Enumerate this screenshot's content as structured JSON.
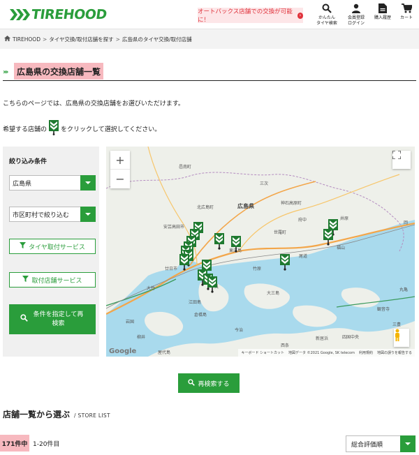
{
  "header": {
    "logo_text": "TIREHOOD",
    "promo_text": "オートバックス店舗での交換が可能に！",
    "nav": [
      {
        "label": "かんたん\nタイヤ検索",
        "icon": "search-icon"
      },
      {
        "label": "会員登録\nログイン",
        "icon": "user-icon"
      },
      {
        "label": "購入履歴",
        "icon": "document-icon"
      },
      {
        "label": "カート",
        "icon": "cart-icon"
      }
    ]
  },
  "breadcrumb": {
    "items": [
      "TIREHOOD",
      "タイヤ交換/取付店舗を探す",
      "広島県のタイヤ交換/取付店舗"
    ],
    "separator": ">"
  },
  "page": {
    "title": "広島県の交換店舗一覧",
    "intro1": "こちらのページでは、広島県の交換店舗をお選びいただけます。",
    "intro2_before": "希望する店舗の",
    "intro2_after": "をクリックして選択してください。"
  },
  "filter": {
    "heading": "絞り込み条件",
    "prefecture": "広島県",
    "city": "市区町村で絞り込む",
    "service_tire": "タイヤ取付サービス",
    "service_shop": "取付店舗サービス",
    "apply_label": "条件を指定して再検索"
  },
  "map": {
    "labels": {
      "prefecture": "広島県",
      "hamada": "浜田",
      "mihara": "三次",
      "ichi": "邑南町",
      "akitaka": "安芸高田市",
      "kitahiro": "北広島町",
      "sera": "世羅町",
      "fuchu": "府中",
      "jinseki": "神石高原町",
      "ibara": "井原",
      "oka": "岡",
      "higashihiro": "東広島",
      "takehara": "竹原",
      "onomichi": "尾道",
      "kannabe": "福山",
      "kure": "呉",
      "etajima": "江田島",
      "kurahashi": "倉橋島",
      "omishima": "大三島",
      "hatsukaichi": "廿日市",
      "iwakuni": "岩国",
      "otake": "大竹",
      "yanai": "柳井",
      "yashiro": "屋代島",
      "saijo": "西条",
      "niihama": "新居浜",
      "imabari": "今治",
      "mitoyo": "三豊",
      "shikoku": "四国中央",
      "kanonji": "観音寺",
      "marugame": "丸亀"
    },
    "footer_shortcuts": "キーボード ショートカット",
    "footer_data": "地図データ ©2021 Google, SK telecom",
    "footer_terms": "利用規約",
    "footer_report": "地図の誤りを報告する",
    "google": "Google",
    "zoom_in": "+",
    "zoom_out": "−"
  },
  "research_label": "再検索する",
  "list": {
    "heading": "店舗一覧から選ぶ",
    "heading_en": "/ STORE LIST",
    "count": "171件中",
    "range": "1-20件目",
    "sort": "総合評価順"
  },
  "colors": {
    "brand": "#2a9d3b",
    "highlight": "#f7b9bf",
    "promo": "#e0323b",
    "water": "#a9daed",
    "land": "#eef0ea"
  }
}
